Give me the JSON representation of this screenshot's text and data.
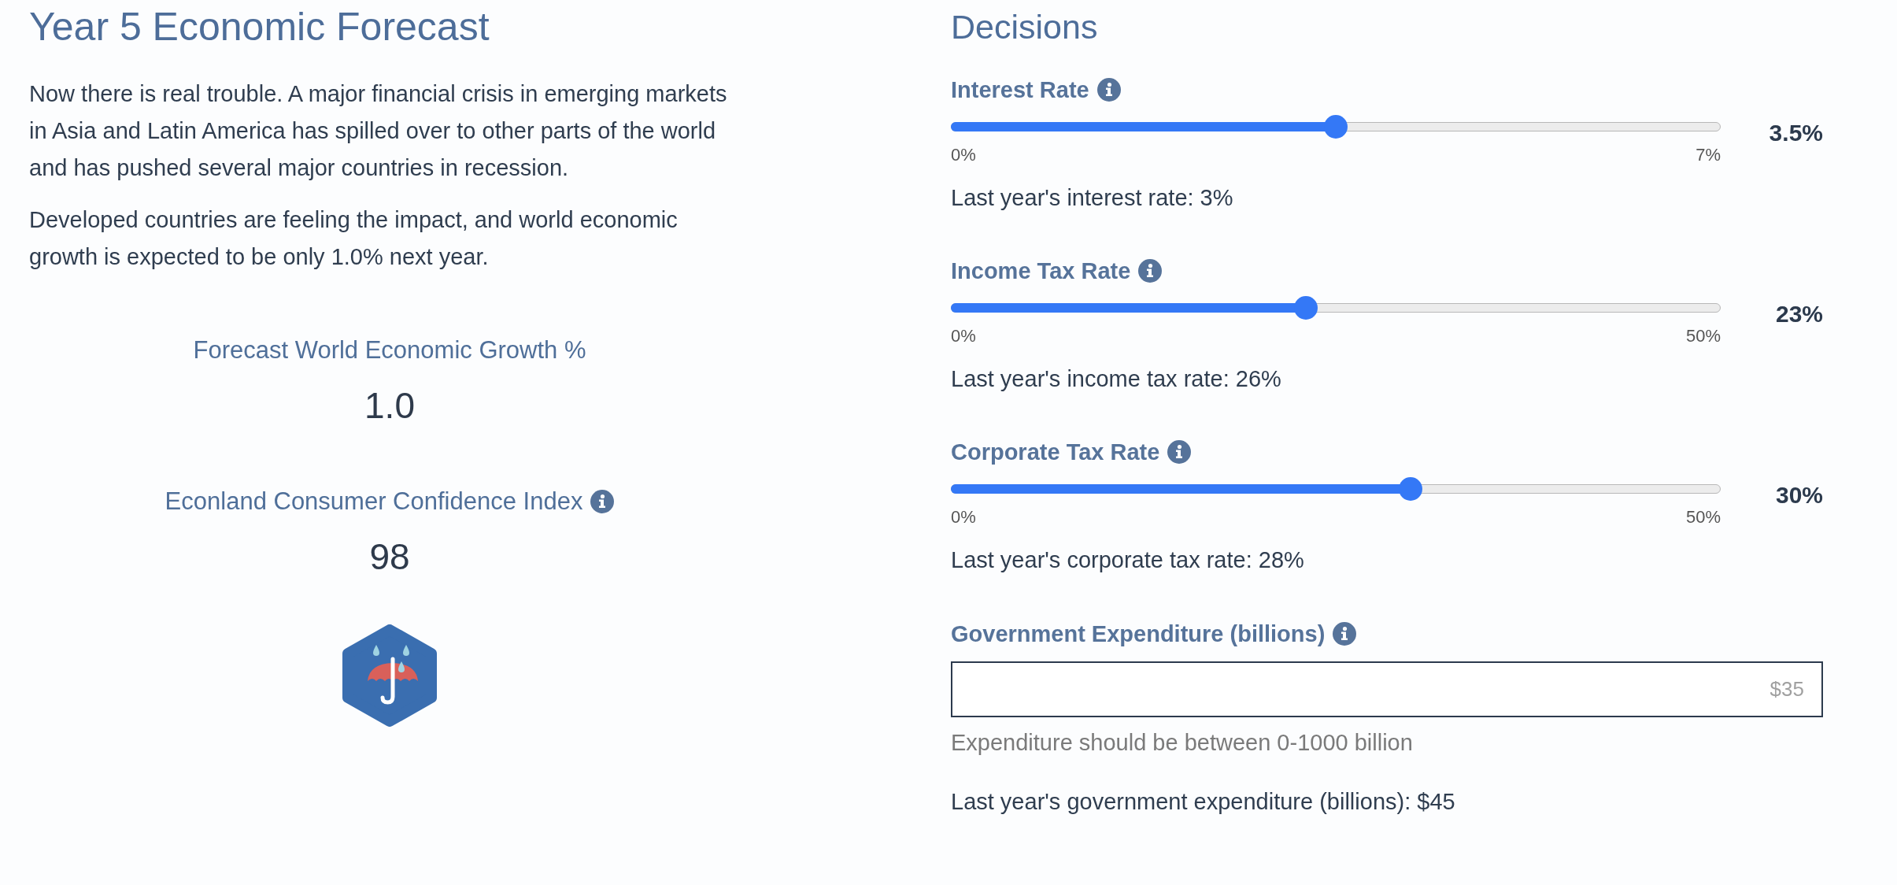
{
  "forecast": {
    "title": "Year 5 Economic Forecast",
    "paragraphs": [
      "Now there is real trouble. A major financial crisis in emerging markets in Asia and Latin America has spilled over to other parts of the world and has pushed several major countries in recession.",
      "Developed countries are feeling the impact, and world economic growth is expected to be only 1.0% next year."
    ],
    "metrics": [
      {
        "label": "Forecast World Economic Growth %",
        "value": "1.0",
        "info": false
      },
      {
        "label": "Econland Consumer Confidence Index",
        "value": "98",
        "info": true
      }
    ]
  },
  "decisions": {
    "title": "Decisions",
    "sliders": [
      {
        "label": "Interest Rate",
        "info": true,
        "level": 0.5,
        "min": "0%",
        "max": "7%",
        "value": "3.5%",
        "last_year": "Last year's interest rate: 3%"
      },
      {
        "label": "Income Tax Rate",
        "info": true,
        "level": 0.46,
        "min": "0%",
        "max": "50%",
        "value": "23%",
        "last_year": "Last year's income tax rate: 26%"
      },
      {
        "label": "Corporate Tax Rate",
        "info": true,
        "level": 0.6,
        "min": "0%",
        "max": "50%",
        "value": "30%",
        "last_year": "Last year's corporate tax rate: 28%"
      }
    ],
    "expenditure": {
      "label": "Government Expenditure (billions)",
      "info": true,
      "placeholder": "$35",
      "hint": "Expenditure should be between 0-1000 billion",
      "last_year": "Last year's government expenditure (billions): $45"
    }
  }
}
